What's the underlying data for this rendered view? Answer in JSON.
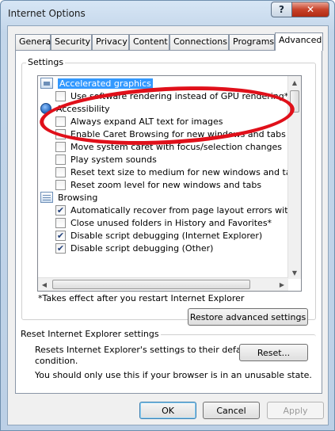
{
  "window": {
    "title": "Internet Options",
    "help_label": "?",
    "close_label": "✕"
  },
  "tabs": [
    {
      "label": "General"
    },
    {
      "label": "Security"
    },
    {
      "label": "Privacy"
    },
    {
      "label": "Content"
    },
    {
      "label": "Connections"
    },
    {
      "label": "Programs"
    },
    {
      "label": "Advanced",
      "active": true
    }
  ],
  "settings": {
    "group_label": "Settings",
    "items": [
      {
        "type": "category",
        "icon": "graphics-card-icon",
        "label": "Accelerated graphics",
        "selected": true
      },
      {
        "type": "checkbox",
        "label": "Use software rendering instead of GPU rendering*",
        "checked": false
      },
      {
        "type": "category",
        "icon": "accessibility-globe-icon",
        "label": "Accessibility"
      },
      {
        "type": "checkbox",
        "label": "Always expand ALT text for images",
        "checked": false
      },
      {
        "type": "checkbox",
        "label": "Enable Caret Browsing for new windows and tabs",
        "checked": false
      },
      {
        "type": "checkbox",
        "label": "Move system caret with focus/selection changes",
        "checked": false
      },
      {
        "type": "checkbox",
        "label": "Play system sounds",
        "checked": false
      },
      {
        "type": "checkbox",
        "label": "Reset text size to medium for new windows and tabs",
        "checked": false
      },
      {
        "type": "checkbox",
        "label": "Reset zoom level for new windows and tabs",
        "checked": false
      },
      {
        "type": "category",
        "icon": "browsing-icon",
        "label": "Browsing"
      },
      {
        "type": "checkbox",
        "label": "Automatically recover from page layout errors with Compa",
        "checked": true
      },
      {
        "type": "checkbox",
        "label": "Close unused folders in History and Favorites*",
        "checked": false
      },
      {
        "type": "checkbox",
        "label": "Disable script debugging (Internet Explorer)",
        "checked": true
      },
      {
        "type": "checkbox",
        "label": "Disable script debugging (Other)",
        "checked": true
      }
    ],
    "footnote": "*Takes effect after you restart Internet Explorer",
    "restore_label": "Restore advanced settings"
  },
  "reset": {
    "group_label": "Reset Internet Explorer settings",
    "description_line1": "Resets Internet Explorer's settings to their default",
    "description_line2": "condition.",
    "warning": "You should only use this if your browser is in an unusable state.",
    "button_label": "Reset..."
  },
  "footer": {
    "ok_label": "OK",
    "cancel_label": "Cancel",
    "apply_label": "Apply"
  },
  "colors": {
    "selection": "#3399ff",
    "annotation": "#e0101a"
  }
}
